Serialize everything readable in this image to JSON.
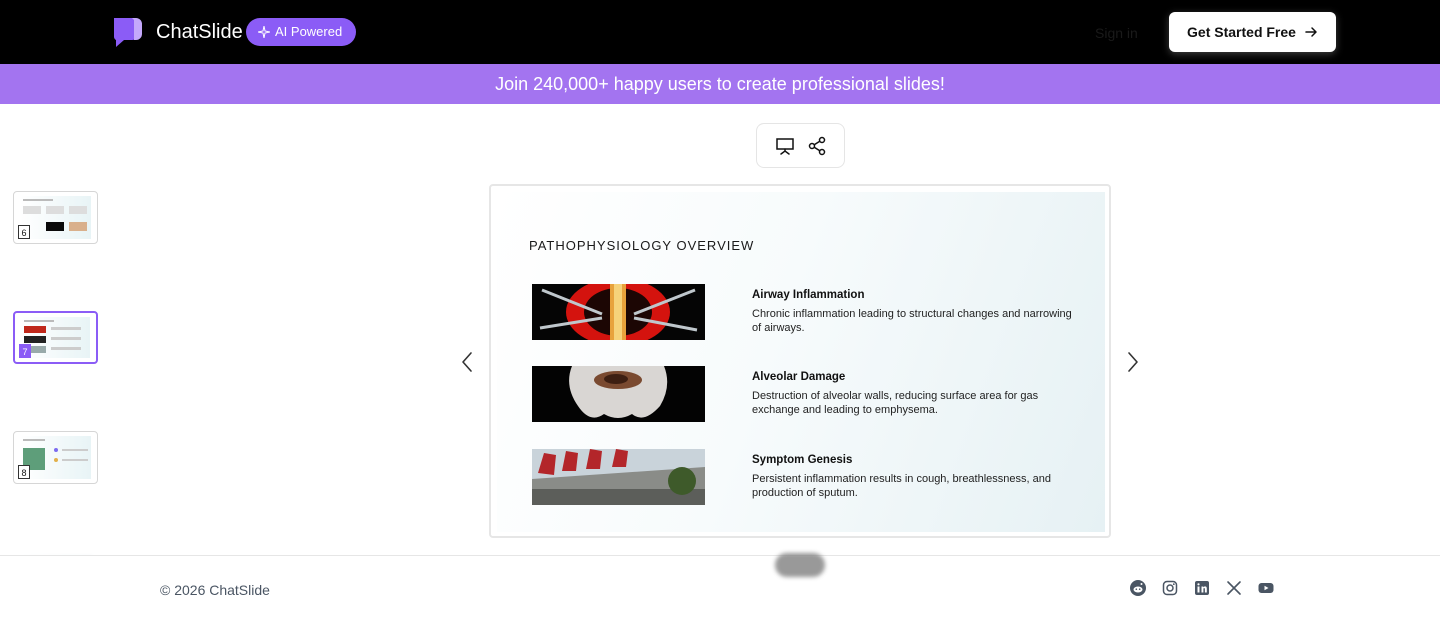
{
  "header": {
    "brand": "ChatSlide",
    "badge": "AI Powered",
    "signin": "Sign in",
    "cta": "Get Started Free"
  },
  "banner": {
    "text": "Join 240,000+ happy users to create professional slides!"
  },
  "thumbnails": [
    {
      "number": "6"
    },
    {
      "number": "7"
    },
    {
      "number": "8"
    }
  ],
  "slide": {
    "title": "PATHOPHYSIOLOGY OVERVIEW",
    "items": [
      {
        "heading": "Airway Inflammation",
        "description": "Chronic inflammation leading to structural changes and narrowing of airways."
      },
      {
        "heading": "Alveolar Damage",
        "description": "Destruction of alveolar walls, reducing surface area for gas exchange and leading to emphysema."
      },
      {
        "heading": "Symptom Genesis",
        "description": "Persistent inflammation results in cough, breathlessness, and production of sputum."
      }
    ]
  },
  "footer": {
    "copyright": "© 2026 ChatSlide",
    "social_icons": [
      "reddit-icon",
      "instagram-icon",
      "linkedin-icon",
      "x-icon",
      "youtube-icon"
    ]
  },
  "colors": {
    "accent": "#8b5cf6",
    "banner": "#a374f0",
    "topbar": "#000000"
  }
}
